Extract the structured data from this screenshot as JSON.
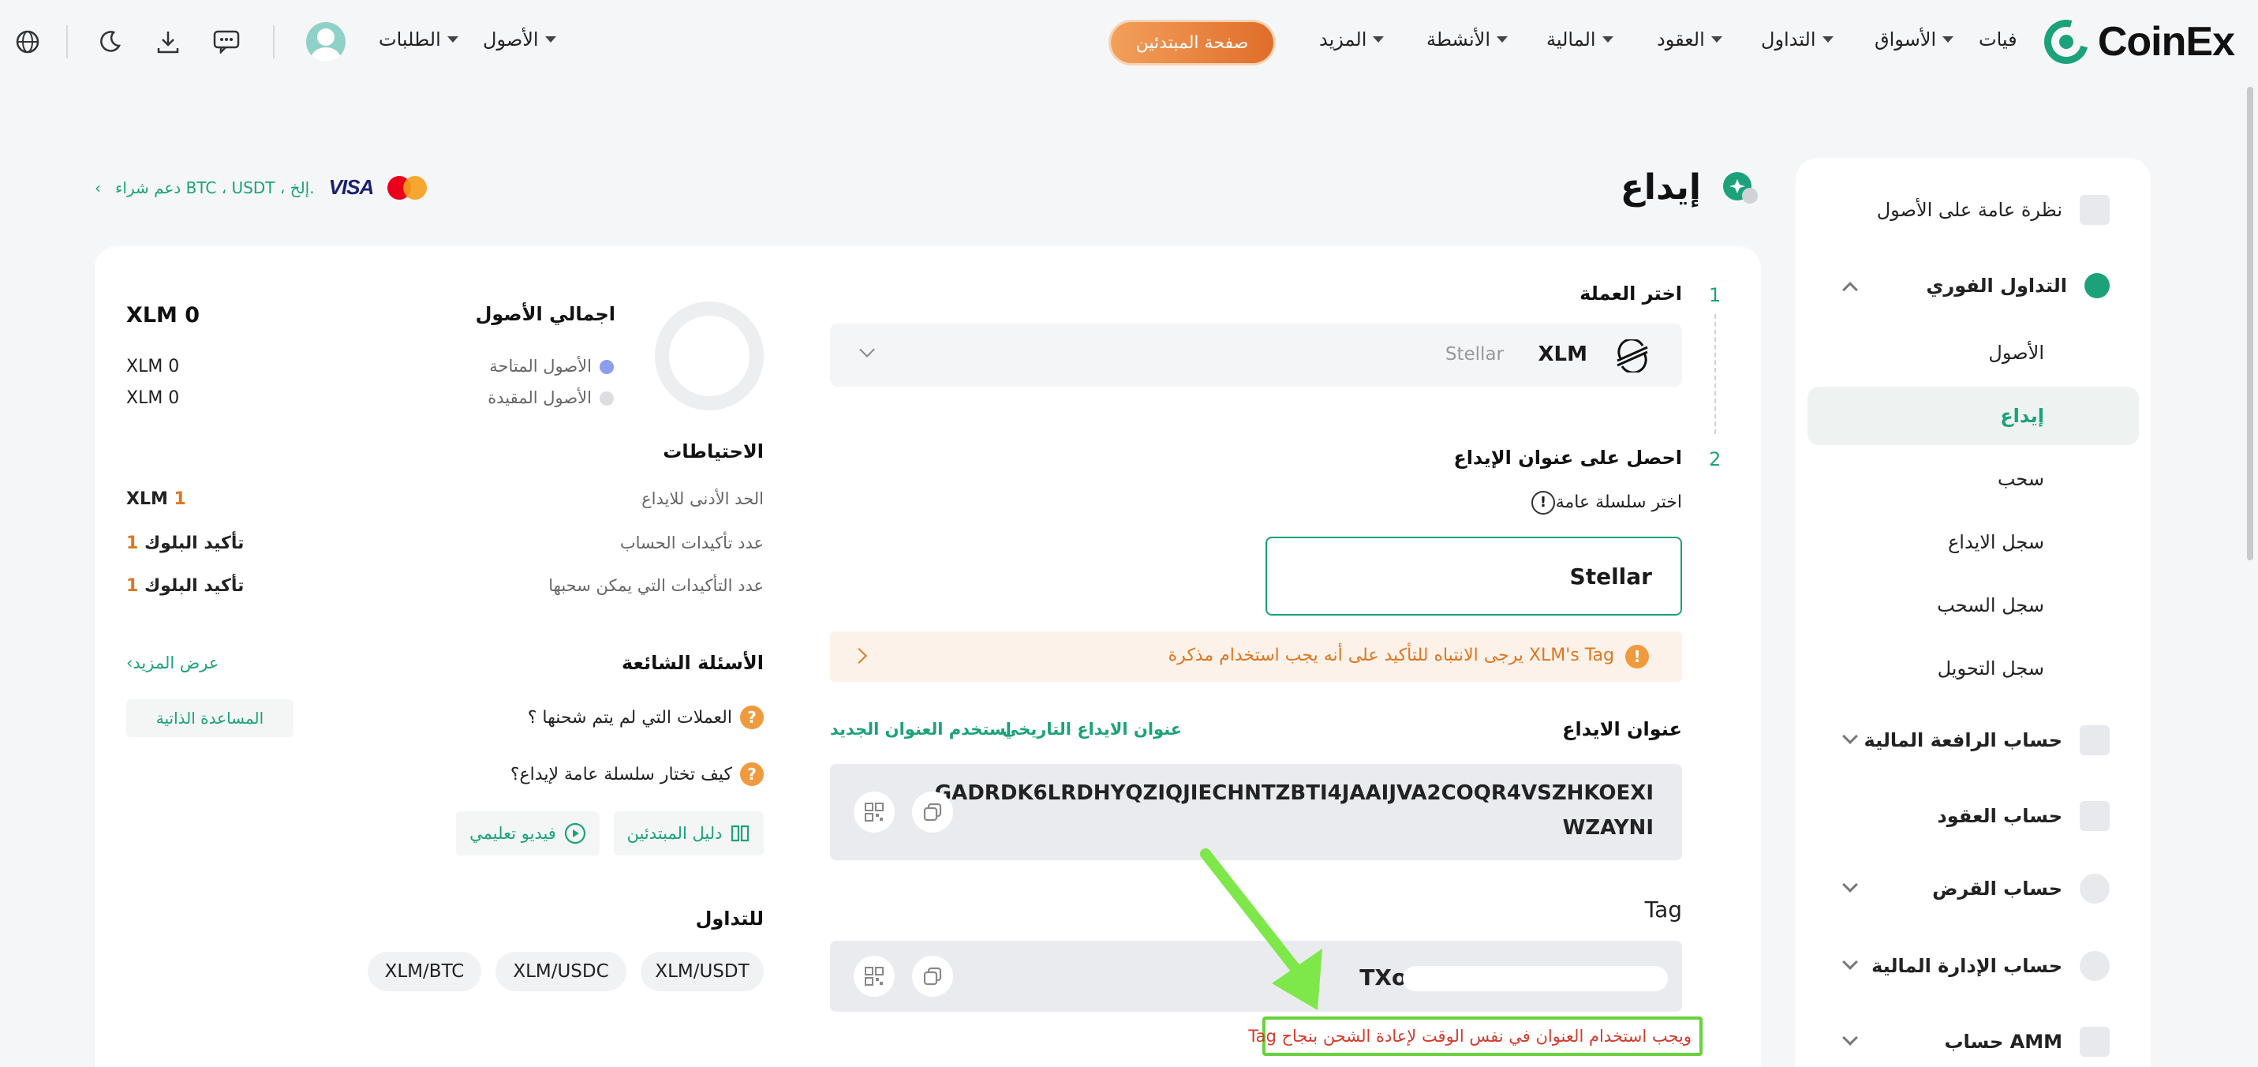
{
  "header": {
    "brand": "CoinEx",
    "nav": {
      "fiat": "فيات",
      "markets": "الأسواق",
      "trade": "التداول",
      "contracts": "العقود",
      "finance": "المالية",
      "activities": "الأنشطة",
      "more": "المزيد",
      "assets": "الأصول",
      "orders": "الطلبات"
    },
    "beginner_button": "صفحة المبتدئين"
  },
  "sidebar": {
    "overview": "نظرة عامة على الأصول",
    "spot": "التداول الفوري",
    "spot_items": [
      "الأصول",
      "إيداع",
      "سحب",
      "سجل الايداع",
      "سجل السحب",
      "سجل التحويل"
    ],
    "active_item": "إيداع",
    "margin": "حساب الرافعة المالية",
    "futures": "حساب العقود",
    "loan": "حساب القرض",
    "wealth": "حساب الإدارة المالية",
    "amm": "حساب AMM"
  },
  "page": {
    "title": "إيداع",
    "crumb_brand_visa": "VISA",
    "crumb_mastercard": "MasterCard",
    "crumb_text": "دعم شراء BTC ، USDT ، إلخ."
  },
  "deposit": {
    "step1_num": "1",
    "step1_title": "اختر العملة",
    "coin_symbol": "XLM",
    "coin_name": "Stellar",
    "step2_num": "2",
    "step2_title": "احصل على عنوان الإيداع",
    "chain_label": "اختر سلسلة عامة",
    "chain_value": "Stellar",
    "warning": "يرجى الانتباه للتأكيد على أنه يجب استخدام مذكرة XLM's Tag",
    "address_label": "عنوان الايداع",
    "history_link": "عنوان الايداع التاريخي",
    "new_link": "استخدم العنوان الجديد",
    "address_line1": "GADRDK6LRDHYQZIQJIECHNTZBTI4JAAIJVA2COQR4VSZHKOEXI",
    "address_line2": "WZAYNI",
    "tag_label": "Tag",
    "tag_value": "TXo(",
    "tag_note": "Tag ويجب استخدام العنوان في نفس الوقت لإعادة الشحن بنجاح"
  },
  "summary": {
    "total_label": "اجمالي الأصول",
    "total_value": "XLM 0",
    "available_label": "الأصول المتاحة",
    "available_value": "XLM 0",
    "frozen_label": "الأصول المقيدة",
    "frozen_value": "XLM 0",
    "reserves_title": "الاحتياطات",
    "min_deposit_label": "الحد الأدنى للايداع",
    "min_deposit_num": "1",
    "min_deposit_unit": "XLM",
    "account_conf_label": "عدد تأكيدات الحساب",
    "account_conf_num": "1",
    "account_conf_unit": "تأكيد البلوك",
    "withdraw_conf_label": "عدد التأكيدات التي يمكن سحبها",
    "withdraw_conf_num": "1",
    "withdraw_conf_unit": "تأكيد البلوك",
    "faq_title": "الأسئلة الشائعة",
    "view_more": "عرض المزيد",
    "self_help": "المساعدة الذاتية",
    "faq1": "العملات التي لم يتم شحنها ؟",
    "faq2": "كيف تختار سلسلة عامة لإيداع؟",
    "guide_button": "دليل المبتدئين",
    "video_button": "فيديو تعليمي",
    "trade_title": "للتداول",
    "pairs": [
      "XLM/USDT",
      "XLM/USDC",
      "XLM/BTC"
    ]
  },
  "colors": {
    "brand": "#1ba27a",
    "warning": "#e0761f",
    "note_border": "#66d33a",
    "arrow": "#7ee84a"
  }
}
